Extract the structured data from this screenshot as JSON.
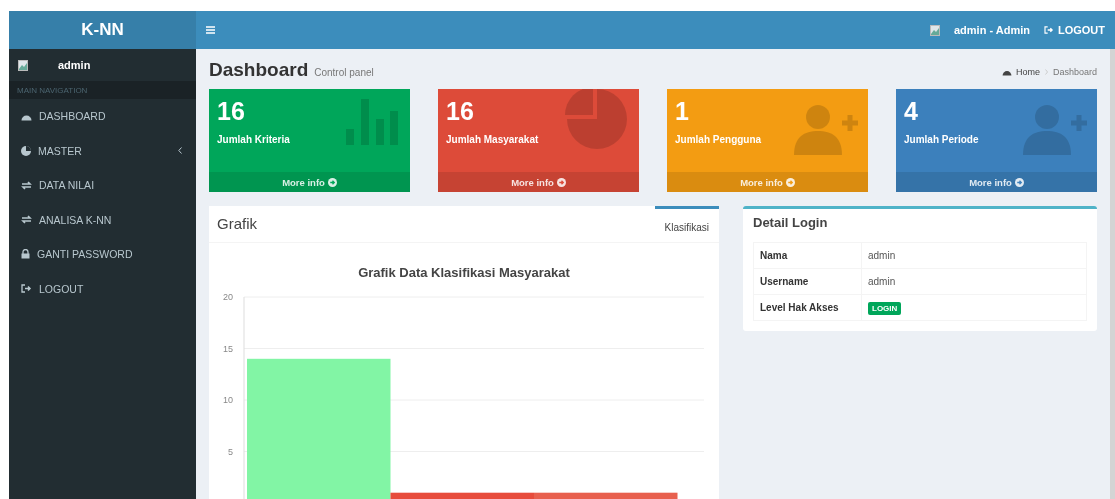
{
  "brand": "K-NN",
  "user_menu": {
    "name": "admin - Admin",
    "logout": "LOGOUT"
  },
  "sidebar": {
    "user": "admin",
    "header": "MAIN NAVIGATION",
    "items": [
      {
        "label": "DASHBOARD",
        "kind": "link"
      },
      {
        "label": "MASTER",
        "kind": "tree"
      },
      {
        "label": "DATA NILAI",
        "kind": "link"
      },
      {
        "label": "ANALISA K-NN",
        "kind": "link"
      },
      {
        "label": "GANTI PASSWORD",
        "kind": "link"
      },
      {
        "label": "LOGOUT",
        "kind": "link"
      }
    ]
  },
  "page_header": {
    "title": "Dashboard",
    "subtitle": "Control panel",
    "breadcrumb": [
      "Home",
      "Dashboard"
    ]
  },
  "stats": [
    {
      "value": "16",
      "label": "Jumlah Kriteria",
      "link": "More info",
      "color": "#00a65a"
    },
    {
      "value": "16",
      "label": "Jumlah Masyarakat",
      "link": "More info",
      "color": "#dd4b39"
    },
    {
      "value": "1",
      "label": "Jumlah Pengguna",
      "link": "More info",
      "color": "#f39c12"
    },
    {
      "value": "4",
      "label": "Jumlah Periode",
      "link": "More info",
      "color": "#3c80bc"
    }
  ],
  "grafik": {
    "title": "Grafik",
    "tab": "Klasifikasi",
    "chart_data": {
      "type": "bar",
      "title": "Grafik Data Klasifikasi Masyarakat",
      "values": [
        14,
        1,
        1
      ],
      "ylim": [
        0,
        20
      ],
      "grid": true,
      "yticks": [
        5,
        10,
        15,
        20
      ]
    }
  },
  "detail_login": {
    "title": "Detail Login",
    "rows": [
      {
        "label": "Nama",
        "value": "admin",
        "kind": "text"
      },
      {
        "label": "Username",
        "value": "admin",
        "kind": "text"
      },
      {
        "label": "Level Hak Akses",
        "value": "LOGIN",
        "kind": "badge"
      }
    ]
  }
}
